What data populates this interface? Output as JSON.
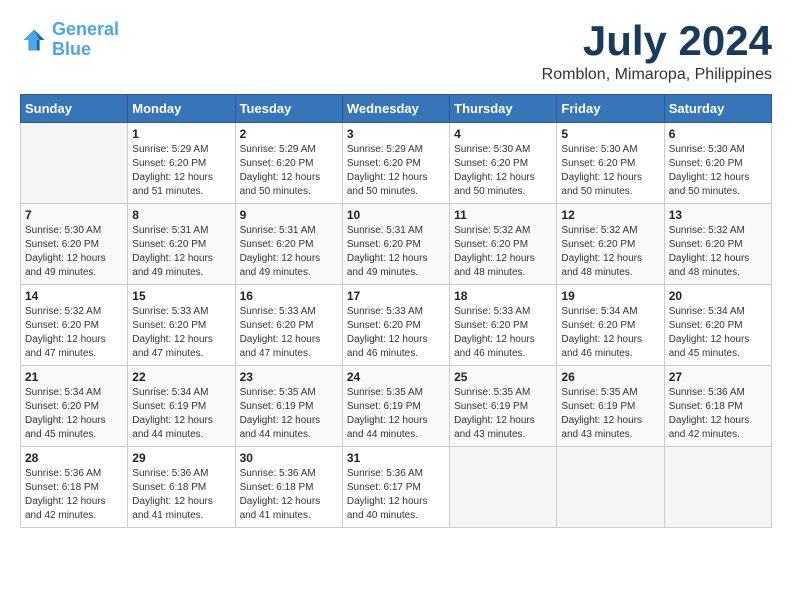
{
  "header": {
    "logo_line1": "General",
    "logo_line2": "Blue",
    "month": "July 2024",
    "location": "Romblon, Mimaropa, Philippines"
  },
  "days_of_week": [
    "Sunday",
    "Monday",
    "Tuesday",
    "Wednesday",
    "Thursday",
    "Friday",
    "Saturday"
  ],
  "weeks": [
    [
      {
        "day": "",
        "sunrise": "",
        "sunset": "",
        "daylight": ""
      },
      {
        "day": "1",
        "sunrise": "5:29 AM",
        "sunset": "6:20 PM",
        "daylight": "12 hours and 51 minutes."
      },
      {
        "day": "2",
        "sunrise": "5:29 AM",
        "sunset": "6:20 PM",
        "daylight": "12 hours and 50 minutes."
      },
      {
        "day": "3",
        "sunrise": "5:29 AM",
        "sunset": "6:20 PM",
        "daylight": "12 hours and 50 minutes."
      },
      {
        "day": "4",
        "sunrise": "5:30 AM",
        "sunset": "6:20 PM",
        "daylight": "12 hours and 50 minutes."
      },
      {
        "day": "5",
        "sunrise": "5:30 AM",
        "sunset": "6:20 PM",
        "daylight": "12 hours and 50 minutes."
      },
      {
        "day": "6",
        "sunrise": "5:30 AM",
        "sunset": "6:20 PM",
        "daylight": "12 hours and 50 minutes."
      }
    ],
    [
      {
        "day": "7",
        "sunrise": "5:30 AM",
        "sunset": "6:20 PM",
        "daylight": "12 hours and 49 minutes."
      },
      {
        "day": "8",
        "sunrise": "5:31 AM",
        "sunset": "6:20 PM",
        "daylight": "12 hours and 49 minutes."
      },
      {
        "day": "9",
        "sunrise": "5:31 AM",
        "sunset": "6:20 PM",
        "daylight": "12 hours and 49 minutes."
      },
      {
        "day": "10",
        "sunrise": "5:31 AM",
        "sunset": "6:20 PM",
        "daylight": "12 hours and 49 minutes."
      },
      {
        "day": "11",
        "sunrise": "5:32 AM",
        "sunset": "6:20 PM",
        "daylight": "12 hours and 48 minutes."
      },
      {
        "day": "12",
        "sunrise": "5:32 AM",
        "sunset": "6:20 PM",
        "daylight": "12 hours and 48 minutes."
      },
      {
        "day": "13",
        "sunrise": "5:32 AM",
        "sunset": "6:20 PM",
        "daylight": "12 hours and 48 minutes."
      }
    ],
    [
      {
        "day": "14",
        "sunrise": "5:32 AM",
        "sunset": "6:20 PM",
        "daylight": "12 hours and 47 minutes."
      },
      {
        "day": "15",
        "sunrise": "5:33 AM",
        "sunset": "6:20 PM",
        "daylight": "12 hours and 47 minutes."
      },
      {
        "day": "16",
        "sunrise": "5:33 AM",
        "sunset": "6:20 PM",
        "daylight": "12 hours and 47 minutes."
      },
      {
        "day": "17",
        "sunrise": "5:33 AM",
        "sunset": "6:20 PM",
        "daylight": "12 hours and 46 minutes."
      },
      {
        "day": "18",
        "sunrise": "5:33 AM",
        "sunset": "6:20 PM",
        "daylight": "12 hours and 46 minutes."
      },
      {
        "day": "19",
        "sunrise": "5:34 AM",
        "sunset": "6:20 PM",
        "daylight": "12 hours and 46 minutes."
      },
      {
        "day": "20",
        "sunrise": "5:34 AM",
        "sunset": "6:20 PM",
        "daylight": "12 hours and 45 minutes."
      }
    ],
    [
      {
        "day": "21",
        "sunrise": "5:34 AM",
        "sunset": "6:20 PM",
        "daylight": "12 hours and 45 minutes."
      },
      {
        "day": "22",
        "sunrise": "5:34 AM",
        "sunset": "6:19 PM",
        "daylight": "12 hours and 44 minutes."
      },
      {
        "day": "23",
        "sunrise": "5:35 AM",
        "sunset": "6:19 PM",
        "daylight": "12 hours and 44 minutes."
      },
      {
        "day": "24",
        "sunrise": "5:35 AM",
        "sunset": "6:19 PM",
        "daylight": "12 hours and 44 minutes."
      },
      {
        "day": "25",
        "sunrise": "5:35 AM",
        "sunset": "6:19 PM",
        "daylight": "12 hours and 43 minutes."
      },
      {
        "day": "26",
        "sunrise": "5:35 AM",
        "sunset": "6:19 PM",
        "daylight": "12 hours and 43 minutes."
      },
      {
        "day": "27",
        "sunrise": "5:36 AM",
        "sunset": "6:18 PM",
        "daylight": "12 hours and 42 minutes."
      }
    ],
    [
      {
        "day": "28",
        "sunrise": "5:36 AM",
        "sunset": "6:18 PM",
        "daylight": "12 hours and 42 minutes."
      },
      {
        "day": "29",
        "sunrise": "5:36 AM",
        "sunset": "6:18 PM",
        "daylight": "12 hours and 41 minutes."
      },
      {
        "day": "30",
        "sunrise": "5:36 AM",
        "sunset": "6:18 PM",
        "daylight": "12 hours and 41 minutes."
      },
      {
        "day": "31",
        "sunrise": "5:36 AM",
        "sunset": "6:17 PM",
        "daylight": "12 hours and 40 minutes."
      },
      {
        "day": "",
        "sunrise": "",
        "sunset": "",
        "daylight": ""
      },
      {
        "day": "",
        "sunrise": "",
        "sunset": "",
        "daylight": ""
      },
      {
        "day": "",
        "sunrise": "",
        "sunset": "",
        "daylight": ""
      }
    ]
  ]
}
